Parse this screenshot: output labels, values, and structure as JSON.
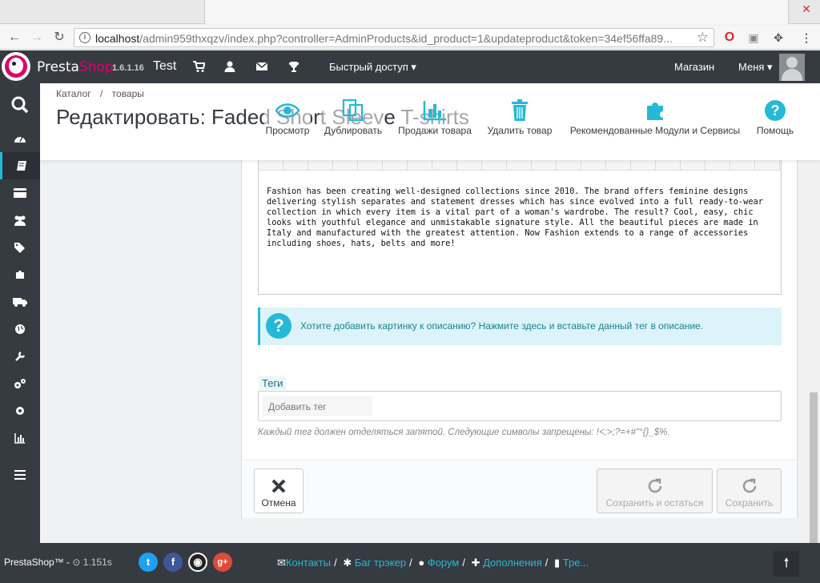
{
  "browser": {
    "url_host": "localhost",
    "url_rest": "/admin959thxqzv/index.php?controller=AdminProducts&id_product=1&updateproduct&token=34ef56ffa89..."
  },
  "header": {
    "brand_presta": "Presta",
    "brand_shop": "Shop",
    "version": "1.6.1.16",
    "shop_name": "Test",
    "quick_access": "Быстрый доступ",
    "shop_link": "Магазин",
    "menu": "Меня"
  },
  "breadcrumb": [
    "Каталог",
    "/",
    "товары"
  ],
  "page_title": "Редактировать: Faded Short Sleeve T-shirts",
  "toolbar": {
    "preview": "Просмотр",
    "duplicate": "Дублировать",
    "sales": "Продажи товара",
    "delete": "Удалить товар",
    "modules": "Рекомендованные Модули и Сервисы",
    "help": "Помощь"
  },
  "description_text": "Fashion has been creating well-designed collections since 2010. The brand offers feminine designs delivering stylish separates and statement dresses which has since evolved into a full ready-to-wear collection in which every item is a vital part of a woman's wardrobe. The result? Cool, easy, chic looks with youthful elegance and unmistakable signature style. All the beautiful pieces are made in Italy and manufactured with the greatest attention. Now Fashion extends to a range of accessories including shoes, hats, belts and more!",
  "alert": {
    "text": "Хотите добавить картинку к описанию? Нажмите здесь и вставьте данный тег в описание."
  },
  "tags": {
    "label": "Теги",
    "placeholder": "Добавить тег",
    "help": "Каждый тег должен отделяться запятой. Следующие символы запрещены: !<;>;?=+#\"°{}_$%."
  },
  "buttons": {
    "cancel": "Отмена",
    "save_stay": "Сохранить и остаться",
    "save": "Сохранить"
  },
  "footer": {
    "brand": "PrestaShop™ - ",
    "time": "1.151s",
    "links": [
      "Контакты",
      "Баг трэкер",
      "Форум",
      "Дополнения",
      "Тре..."
    ]
  },
  "colors": {
    "dark": "#363a41",
    "accent": "#25b9d7",
    "brand_pink": "#df0067"
  }
}
